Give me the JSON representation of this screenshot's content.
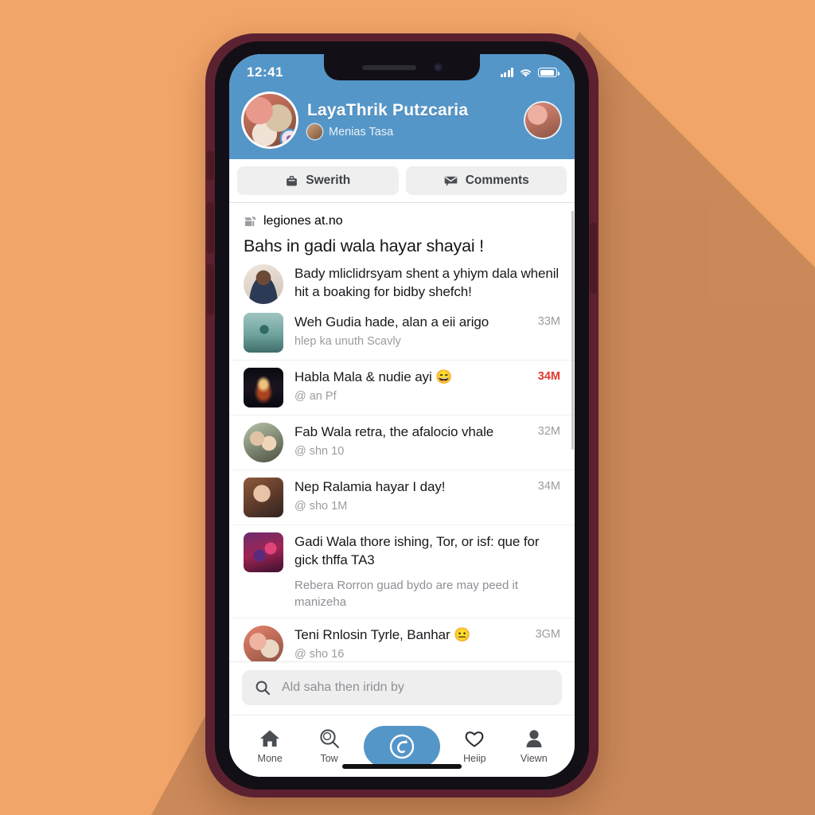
{
  "theme": {
    "background": "#f2a568",
    "shadow": "#c08054",
    "phone_frame": "#5c2130",
    "accent_blue": "#5596c8",
    "alert_red": "#e2392f",
    "chip_grey": "#efeff0"
  },
  "status_bar": {
    "clock": "12:41",
    "signal_icon": "cellular-bars-icon",
    "wifi_icon": "wifi-icon",
    "battery_icon": "battery-full-icon"
  },
  "header": {
    "avatar_icon": "profile-avatar",
    "avatar_badge_icon": "status-badge-icon",
    "title": "LayaThrik Putzcaria",
    "subtitle_avatar_icon": "small-avatar",
    "subtitle": "Menias Tasa",
    "right_avatar_icon": "secondary-avatar"
  },
  "tabs": [
    {
      "label": "Swerith",
      "icon": "briefcase-icon",
      "active": false
    },
    {
      "label": "Comments",
      "icon": "comment-envelope-icon",
      "active": false
    }
  ],
  "post": {
    "source_icon": "broadcast-icon",
    "source_label": "legiones at.no",
    "title": "Bahs in gadi wala hayar shayai !"
  },
  "feed": [
    {
      "thumb": "art-man1",
      "thumb_shape": "circle",
      "title": "Bady mliclidrsyam shent a yhiym dala whenil hit a boaking for bidby shefch!",
      "subtitle": "",
      "extra": "",
      "time": "",
      "time_alert": false
    },
    {
      "thumb": "art-statue",
      "thumb_shape": "square",
      "title": "Weh Gudia hade, alan a eii arigo",
      "subtitle": "hlep ka unuth Scavly",
      "extra": "",
      "time": "33M",
      "time_alert": false
    },
    {
      "thumb": "art-night",
      "thumb_shape": "square",
      "title": "Habla Mala & nudie ayi 😄",
      "subtitle": "@ an Pf",
      "extra": "",
      "time": "34M",
      "time_alert": true
    },
    {
      "thumb": "art-couple",
      "thumb_shape": "circle",
      "title": "Fab Wala retra, the afalocio vhale",
      "subtitle": "@ shn 10",
      "extra": "",
      "time": "32M",
      "time_alert": false
    },
    {
      "thumb": "art-woman",
      "thumb_shape": "square",
      "title": "Nep Ralamia hayar I day!",
      "subtitle": "@ sho 1M",
      "extra": "",
      "time": "34M",
      "time_alert": false
    },
    {
      "thumb": "art-crowd",
      "thumb_shape": "square",
      "title": "Gadi Wala thore ishing, Tor, or isf: que for gick thffa TA3",
      "subtitle": "",
      "extra": "Rebera Rorron guad bydo are may peed it manizeha",
      "time": "",
      "time_alert": false
    },
    {
      "thumb": "art-pair",
      "thumb_shape": "circle",
      "title": "Teni Rnlosin Tyrle, Banhar 😐",
      "subtitle": "@ sho 16",
      "extra": "",
      "time": "3GM",
      "time_alert": false
    }
  ],
  "search": {
    "icon": "search-icon",
    "value": "",
    "placeholder": "Ald saha then iridn by"
  },
  "bottom_nav": [
    {
      "label": "Mone",
      "icon": "home-icon",
      "active": false
    },
    {
      "label": "Tow",
      "icon": "search-magnifier-icon",
      "active": false
    },
    {
      "label": "",
      "icon": "refresh-circle-icon",
      "active": true
    },
    {
      "label": "Heiip",
      "icon": "heart-icon",
      "active": false
    },
    {
      "label": "Viewn",
      "icon": "person-icon",
      "active": false
    }
  ]
}
